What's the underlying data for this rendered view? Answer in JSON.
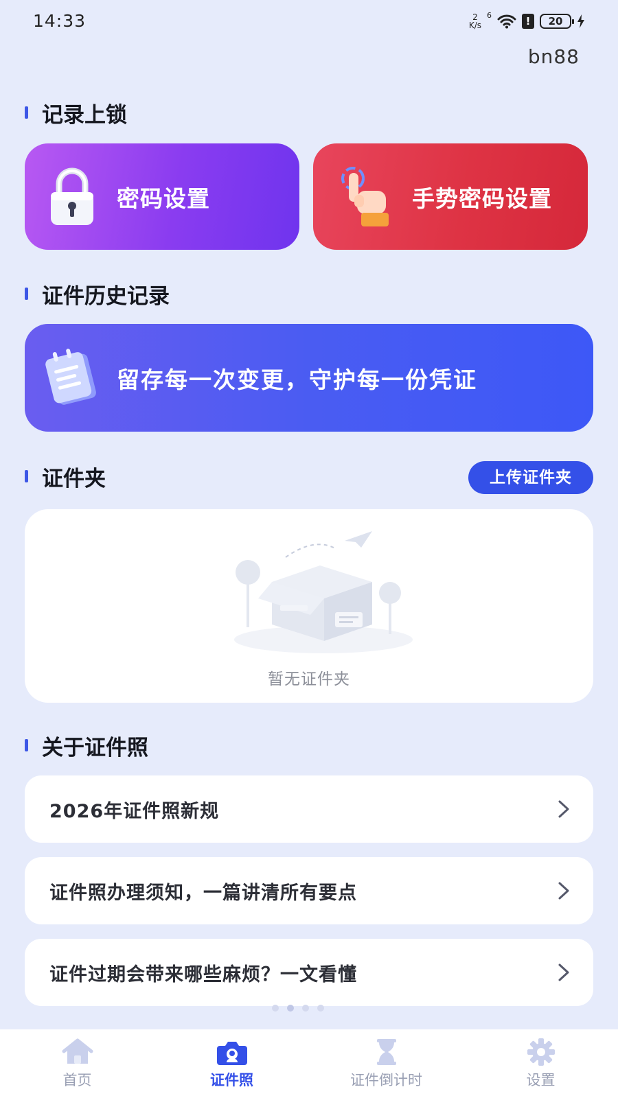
{
  "status_bar": {
    "time": "14:33",
    "net_speed_value": "2",
    "net_speed_unit": "K/s",
    "wifi_badge": "6",
    "battery": "20"
  },
  "user_tag": "bn88",
  "sections": {
    "lock": "记录上锁",
    "history": "证件历史记录",
    "folder": "证件夹",
    "about": "关于证件照"
  },
  "lock_cards": {
    "password_label": "密码设置",
    "gesture_label": "手势密码设置"
  },
  "history_banner": {
    "text": "留存每一次变更，守护每一份凭证"
  },
  "folder": {
    "upload_label": "上传证件夹",
    "empty_text": "暂无证件夹"
  },
  "articles": [
    {
      "title": "2026年证件照新规"
    },
    {
      "title": "证件照办理须知，一篇讲清所有要点"
    },
    {
      "title": "证件过期会带来哪些麻烦？一文看懂"
    }
  ],
  "bottom_nav": [
    {
      "label": "首页",
      "icon": "home-icon"
    },
    {
      "label": "证件照",
      "icon": "camera-icon",
      "active": true
    },
    {
      "label": "证件倒计时",
      "icon": "hourglass-icon"
    },
    {
      "label": "设置",
      "icon": "gear-icon"
    }
  ],
  "colors": {
    "background": "#e6ebfb",
    "accent": "#3450e8",
    "password_card": "#8a3cf0",
    "gesture_card": "#de3344",
    "history_banner": "#4a5cf2"
  }
}
